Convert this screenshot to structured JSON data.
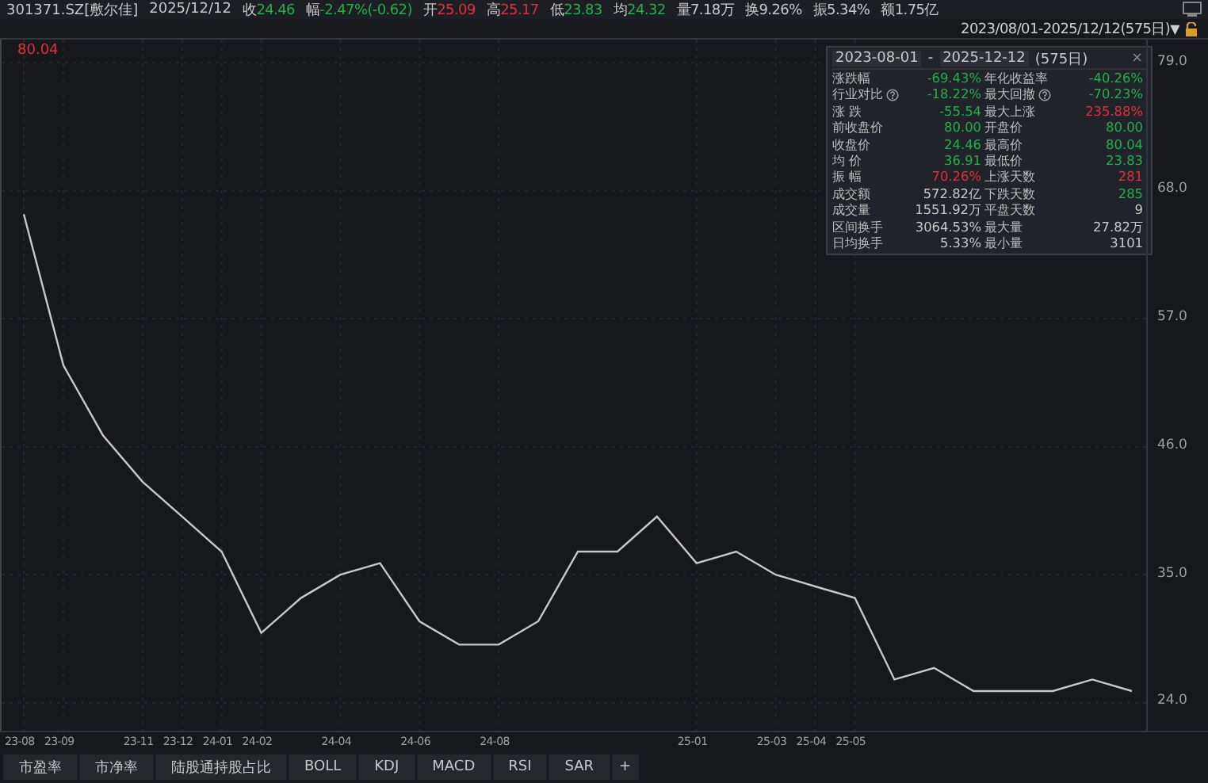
{
  "quote_bar": {
    "code": "301371.SZ[敷尔佳]",
    "date": "2025/12/12",
    "fields": [
      {
        "label": "收",
        "value": "24.46",
        "color": "#22b04a"
      },
      {
        "label": "幅",
        "value": "-2.47%(-0.62)",
        "color": "#22b04a"
      },
      {
        "label": "开",
        "value": "25.09",
        "color": "#e0303a"
      },
      {
        "label": "高",
        "value": "25.17",
        "color": "#e0303a"
      },
      {
        "label": "低",
        "value": "23.83",
        "color": "#22b04a"
      },
      {
        "label": "均",
        "value": "24.32",
        "color": "#22b04a"
      },
      {
        "label": "量",
        "value": "7.18万",
        "color": "#c8c8c8"
      },
      {
        "label": "换",
        "value": "9.26%",
        "color": "#c8c8c8"
      },
      {
        "label": "振",
        "value": "5.34%",
        "color": "#c8c8c8"
      },
      {
        "label": "额",
        "value": "1.75亿",
        "color": "#c8c8c8"
      }
    ]
  },
  "range_selector": {
    "value": "2023/08/01-2025/12/12(575日)",
    "caret": "▼"
  },
  "max_label": "80.04",
  "stats_panel": {
    "start": "2023-08-01",
    "separator": "-",
    "end": "2025-12-12",
    "days": "(575日)",
    "close": "×",
    "rows": [
      [
        {
          "label": "涨跌幅",
          "value": "-69.43%",
          "color": "#22b04a"
        },
        {
          "label": "年化收益率",
          "value": "-40.26%",
          "color": "#22b04a"
        }
      ],
      [
        {
          "label": "行业对比",
          "value": "-18.22%",
          "color": "#22b04a",
          "info": true
        },
        {
          "label": "最大回撤",
          "value": "-70.23%",
          "color": "#22b04a",
          "info": true
        }
      ],
      [
        {
          "label": "涨 跌",
          "value": "-55.54",
          "color": "#22b04a"
        },
        {
          "label": "最大上涨",
          "value": "235.88%",
          "color": "#e0303a"
        }
      ],
      [
        {
          "label": "前收盘价",
          "value": "80.00",
          "color": "#22b04a"
        },
        {
          "label": "开盘价",
          "value": "80.00",
          "color": "#22b04a"
        }
      ],
      [
        {
          "label": "收盘价",
          "value": "24.46",
          "color": "#22b04a"
        },
        {
          "label": "最高价",
          "value": "80.04",
          "color": "#22b04a"
        }
      ],
      [
        {
          "label": "均 价",
          "value": "36.91",
          "color": "#22b04a"
        },
        {
          "label": "最低价",
          "value": "23.83",
          "color": "#22b04a"
        }
      ],
      [
        {
          "label": "振 幅",
          "value": "70.26%",
          "color": "#e0303a"
        },
        {
          "label": "上涨天数",
          "value": "281",
          "color": "#e0303a"
        }
      ],
      [
        {
          "label": "成交额",
          "value": "572.82亿",
          "color": "#c8c8c8"
        },
        {
          "label": "下跌天数",
          "value": "285",
          "color": "#22b04a"
        }
      ],
      [
        {
          "label": "成交量",
          "value": "1551.92万",
          "color": "#c8c8c8"
        },
        {
          "label": "平盘天数",
          "value": "9",
          "color": "#c8c8c8"
        }
      ],
      [
        {
          "label": "区间换手",
          "value": "3064.53%",
          "color": "#c8c8c8"
        },
        {
          "label": "最大量",
          "value": "27.82万",
          "color": "#c8c8c8"
        }
      ],
      [
        {
          "label": "日均换手",
          "value": "5.33%",
          "color": "#c8c8c8"
        },
        {
          "label": "最小量",
          "value": "3101",
          "color": "#c8c8c8"
        }
      ]
    ]
  },
  "chart_data": {
    "type": "line",
    "categories": [
      "23-08",
      "23-09",
      null,
      "23-11",
      "23-12",
      "24-01",
      "24-02",
      null,
      "24-04",
      null,
      "24-06",
      null,
      "24-08",
      null,
      null,
      null,
      null,
      "25-01",
      null,
      "25-03",
      "25-04",
      "25-05",
      null,
      null,
      null,
      null,
      null,
      null,
      null
    ],
    "series": [
      {
        "color": "#c8c8c8",
        "values": [
          66,
          53,
          47,
          43,
          40,
          37,
          30,
          33,
          35,
          36,
          31,
          29,
          29,
          31,
          37,
          37,
          40,
          36,
          37,
          35,
          34,
          33,
          26,
          27,
          25,
          25,
          25,
          26,
          25
        ]
      }
    ],
    "ylim": [
      21.6,
      81
    ],
    "grid": true,
    "yticks": [
      {
        "value": 79,
        "label": "79.0"
      },
      {
        "value": 68,
        "label": "68.0"
      },
      {
        "value": 57,
        "label": "57.0"
      },
      {
        "value": 46,
        "label": "46.0"
      },
      {
        "value": 35,
        "label": "35.0"
      },
      {
        "value": 24,
        "label": "24.0"
      }
    ]
  },
  "indicator_tabs": [
    {
      "label": "市盈率",
      "selected": false
    },
    {
      "label": "市净率",
      "selected": false
    },
    {
      "label": "陆股通持股占比",
      "selected": false
    },
    {
      "label": "BOLL",
      "selected": false
    },
    {
      "label": "KDJ",
      "selected": false
    },
    {
      "label": "MACD",
      "selected": false
    },
    {
      "label": "RSI",
      "selected": false
    },
    {
      "label": "SAR",
      "selected": false
    }
  ],
  "add_tab": "+"
}
